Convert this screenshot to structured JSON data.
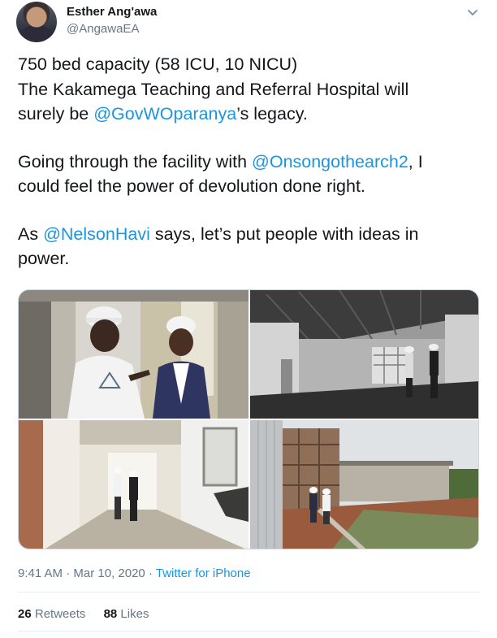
{
  "author": {
    "name": "Esther Ang'awa",
    "handle": "@AngawaEA"
  },
  "tweet": {
    "line1": "750 bed capacity (58 ICU, 10 NICU)",
    "line2": "The Kakamega Teaching and Referral Hospital will",
    "line3_pre": "surely be ",
    "line3_mention": "@GovWOparanya",
    "line3_post": "’s legacy.",
    "line4_pre": "Going through the facility with ",
    "line4_mention": "@Onsongothearch2",
    "line4_post": ", I",
    "line5": "could feel the power of devolution done right.",
    "line6_pre": "As ",
    "line6_mention": "@NelsonHavi",
    "line6_post": " says, let’s put people with ideas in",
    "line7": "power."
  },
  "meta": {
    "time": "9:41 AM",
    "separator1": "·",
    "date": "Mar 10, 2020",
    "separator2": "·",
    "source": "Twitter for iPhone"
  },
  "stats": {
    "retweets_count": "26",
    "retweets_label": "Retweets",
    "likes_count": "88",
    "likes_label": "Likes"
  },
  "icons": {
    "caret": "chevron-down-icon"
  },
  "colors": {
    "link": "#1b95e0",
    "secondary_text": "#657786",
    "primary_text": "#14171a"
  }
}
